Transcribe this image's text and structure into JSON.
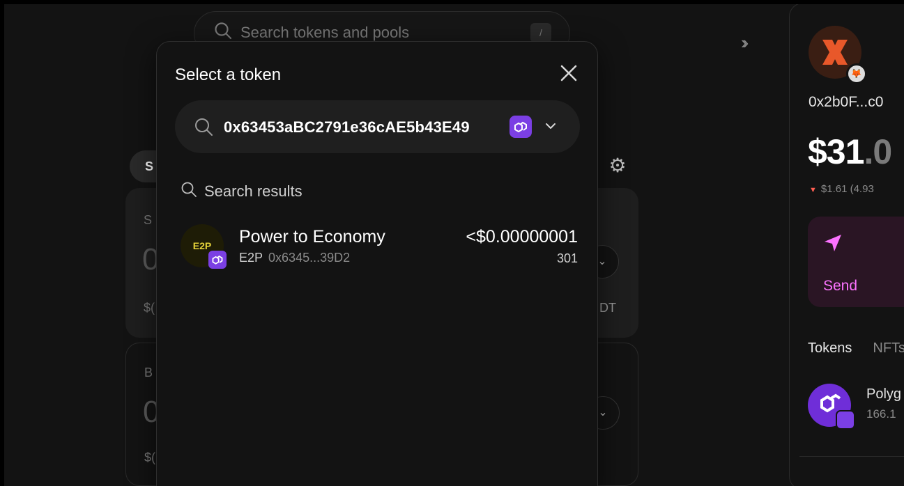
{
  "background": {
    "search_placeholder": "Search tokens and pools",
    "search_shortcut": "/",
    "tab_fragment": "S",
    "card1_label_fragment": "S",
    "card1_amount_fragment": "0",
    "card1_usd_fragment": "$(",
    "card1_token_fragment": "DT",
    "card2_label_fragment": "B",
    "card2_amount_fragment": "0",
    "card2_usd_fragment": "$("
  },
  "wallet": {
    "address": "0x2b0F...c0",
    "balance_int": "$31",
    "balance_dec": ".0",
    "change": "$1.61 (4.93",
    "send_label": "Send",
    "tabs": [
      "Tokens",
      "NFTs"
    ],
    "token_name": "Polyg",
    "token_amount": "166.1"
  },
  "modal": {
    "title": "Select a token",
    "search_value": "0x63453aBC2791e36cAE5b43E49",
    "results_header": "Search results",
    "results": [
      {
        "logo_text": "E2P",
        "name": "Power to Economy",
        "symbol": "E2P",
        "address": "0x6345...39D2",
        "price": "<$0.00000001",
        "balance": "301"
      }
    ]
  },
  "colors": {
    "accent_pink": "#fc72ff",
    "polygon_purple": "#7b3fe4",
    "negative_red": "#ff5f52"
  }
}
